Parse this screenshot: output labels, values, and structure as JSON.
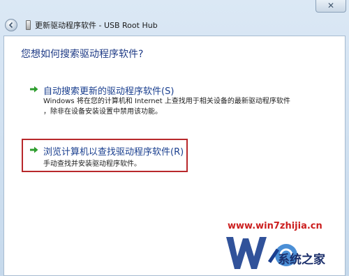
{
  "window": {
    "title": "更新驱动程序软件 - USB Root Hub",
    "close_glyph": "✕"
  },
  "main": {
    "question": "您想如何搜索驱动程序软件?",
    "options": [
      {
        "title": "自动搜索更新的驱动程序软件(S)",
        "desc_line1": "Windows 将在您的计算机和 Internet 上查找用于相关设备的最新驱动程序软件",
        "desc_line2": "，除非在设备安装设置中禁用该功能。"
      },
      {
        "title": "浏览计算机以查找驱动程序软件(R)",
        "desc_line1": "手动查找并安装驱动程序软件。"
      }
    ]
  },
  "watermark": {
    "url": "www.win7zhijia.cn",
    "brand": "系统之家"
  },
  "colors": {
    "link": "#1a3f8f",
    "heading": "#1f3b86",
    "highlight_border": "#b8282b",
    "arrow": "#2e9d2e"
  }
}
